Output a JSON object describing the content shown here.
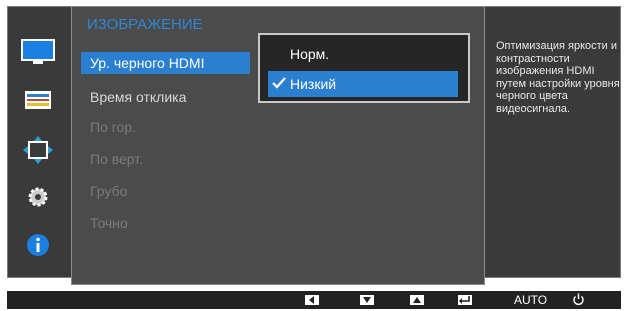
{
  "menu": {
    "title": "ИЗОБРАЖЕНИЕ",
    "items": [
      {
        "label": "Ур. черного HDMI",
        "state": "selected"
      },
      {
        "label": "Время отклика",
        "state": "normal"
      },
      {
        "label": "По гор.",
        "state": "disabled"
      },
      {
        "label": "По верт.",
        "state": "disabled"
      },
      {
        "label": "Грубо",
        "state": "disabled"
      },
      {
        "label": "Точно",
        "state": "disabled"
      }
    ]
  },
  "submenu": {
    "options": [
      {
        "label": "Норм.",
        "selected": false
      },
      {
        "label": "Низкий",
        "selected": true
      }
    ]
  },
  "description": "Оптимизация яркости и контрастности изображения HDMI путем настройки уровня черного цвета видеосигнала.",
  "sidebar": {
    "icons": [
      "picture-icon",
      "color-icon",
      "size-position-icon",
      "setup-icon",
      "information-icon"
    ]
  },
  "bottom_bar": {
    "auto_label": "AUTO"
  },
  "colors": {
    "accent": "#2a7fd0",
    "title": "#2f86d8",
    "panel": "#4b4b4b",
    "background": "#3a3a3a"
  }
}
